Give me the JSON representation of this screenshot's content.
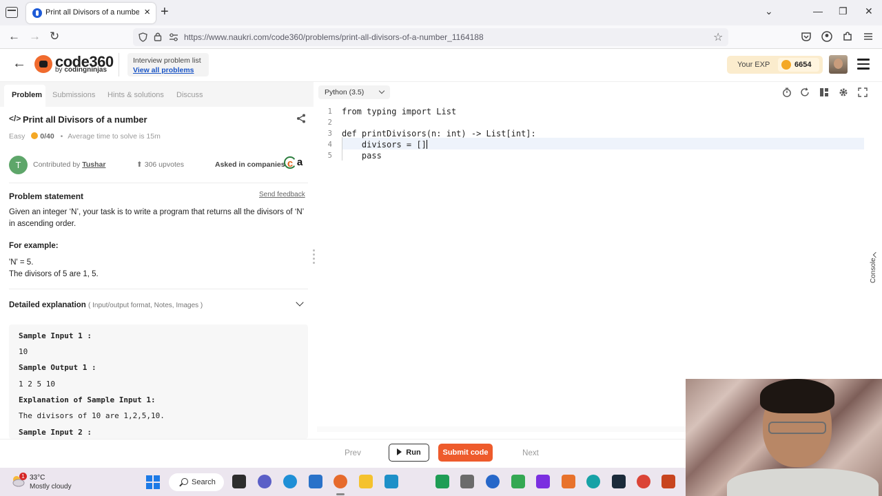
{
  "browser": {
    "tab_title": "Print all Divisors of a number - …",
    "url": "https://www.naukri.com/code360/problems/print-all-divisors-of-a-number_1164188"
  },
  "header": {
    "logo_name": "code360",
    "logo_by": "by",
    "logo_brand": "codingninjas",
    "problem_list_label": "Interview problem list",
    "problem_list_link": "View all problems",
    "exp_label": "Your EXP",
    "exp_value": "6654"
  },
  "left_panel": {
    "tabs": [
      {
        "label": "Problem"
      },
      {
        "label": "Submissions"
      },
      {
        "label": "Hints & solutions"
      },
      {
        "label": "Discuss"
      }
    ],
    "problem_title": "Print all Divisors of a number",
    "difficulty": "Easy",
    "score": "0/40",
    "avg_time": "Average time to solve is 15m",
    "contributor_initial": "T",
    "contributed_by": "Contributed by",
    "contributor_name": "Tushar",
    "upvotes": "306 upvotes",
    "asked_in": "Asked in companies",
    "statement_heading": "Problem statement",
    "send_feedback": "Send feedback",
    "statement_text": "Given an integer ‘N’, your task is to write a program that returns all the divisors of ‘N’ in ascending order.",
    "example_heading": "For example:",
    "example_lines": [
      "'N' = 5.",
      "The divisors of 5 are 1, 5."
    ],
    "detail_heading": "Detailed explanation",
    "detail_sub": "( Input/output format, Notes, Images )",
    "samples": [
      "Sample Input 1 :",
      "10",
      "Sample Output 1 :",
      "1 2 5 10",
      "Explanation of Sample Input 1:",
      "The divisors of 10 are 1,2,5,10.",
      "Sample Input 2 :"
    ]
  },
  "editor": {
    "language": "Python (3.5)",
    "line_numbers": [
      "1",
      "2",
      "3",
      "4",
      "5"
    ],
    "code_lines": [
      "from typing import List",
      "",
      "def printDivisors(n: int) -> List[int]:",
      "    divisors = []",
      "    pass"
    ],
    "console_label": "Console"
  },
  "actions": {
    "prev": "Prev",
    "run": "Run",
    "submit": "Submit code",
    "next": "Next"
  },
  "taskbar": {
    "weather_badge": "1",
    "temperature": "33°C",
    "weather": "Mostly cloudy",
    "search": "Search"
  },
  "colors": {
    "brand_orange": "#ee5b2c",
    "link_blue": "#1a55c6",
    "exp_bg": "#fbeccd"
  }
}
